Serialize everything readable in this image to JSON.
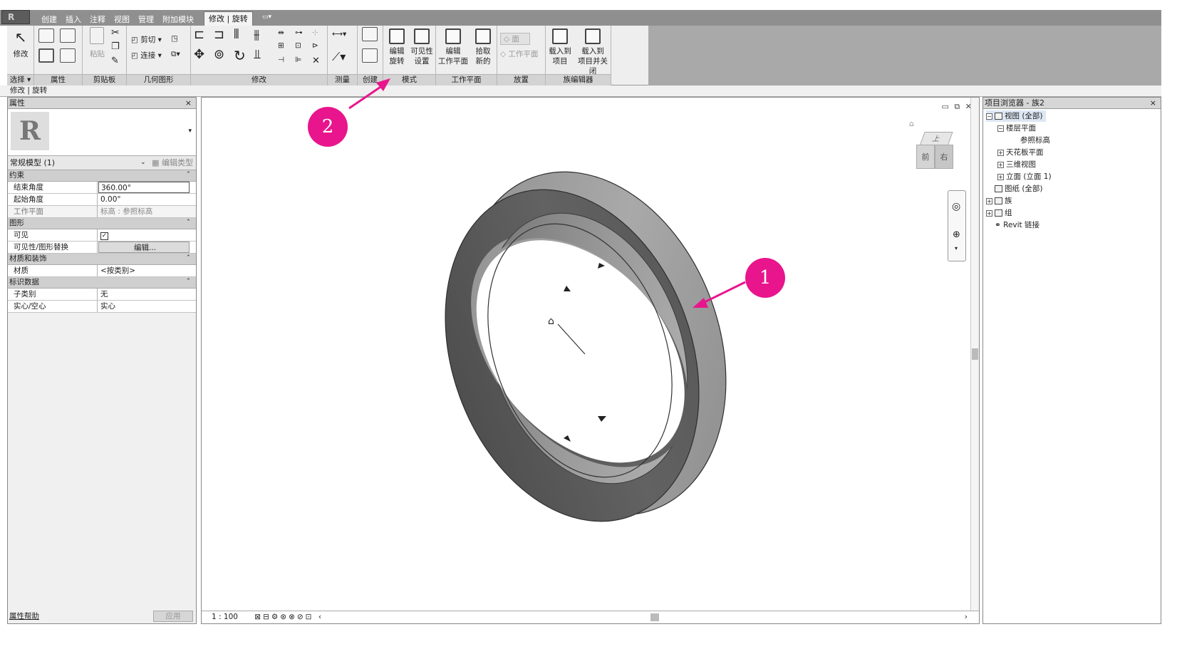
{
  "ribbon": {
    "tabs": [
      "创建",
      "插入",
      "注释",
      "视图",
      "管理",
      "附加模块",
      "修改 | 旋转"
    ],
    "active_tab": "修改 | 旋转",
    "panels": {
      "select": "选择 ▾",
      "properties": "属性",
      "clipboard": "剪贴板",
      "geometry": "几何图形",
      "modify": "修改",
      "measure": "测量",
      "create": "创建",
      "mode": "模式",
      "workplane": "工作平面",
      "place": "放置",
      "family_editor": "族编辑器"
    },
    "buttons": {
      "modify": "修改",
      "paste": "粘贴",
      "cut": "剪切",
      "join": "连接",
      "edit_revolve_1": "编辑",
      "edit_revolve_2": "旋转",
      "visibility_1": "可见性",
      "visibility_2": "设置",
      "edit_wp_1": "编辑",
      "edit_wp_2": "工作平面",
      "pick_new_1": "拾取",
      "pick_new_2": "新的",
      "place_face": "面",
      "place_wp": "工作平面",
      "load_project_1": "载入到",
      "load_project_2": "项目",
      "load_close_1": "载入到",
      "load_close_2": "项目并关闭"
    }
  },
  "context_bar": "修改 | 旋转",
  "properties": {
    "title": "属性",
    "close": "×",
    "type_name": "常规模型 (1)",
    "edit_type": "编辑类型",
    "groups": [
      {
        "name": "约束",
        "rows": [
          {
            "key": "结束角度",
            "value": "360.00°"
          },
          {
            "key": "起始角度",
            "value": "0.00°"
          },
          {
            "key": "工作平面",
            "value": "标高 : 参照标高"
          }
        ]
      },
      {
        "name": "图形",
        "rows": [
          {
            "key": "可见",
            "value": "☑"
          },
          {
            "key": "可见性/图形替换",
            "value": "编辑..."
          }
        ]
      },
      {
        "name": "材质和装饰",
        "rows": [
          {
            "key": "材质",
            "value": "<按类别>"
          }
        ]
      },
      {
        "name": "标识数据",
        "rows": [
          {
            "key": "子类别",
            "value": "无"
          },
          {
            "key": "实心/空心",
            "value": "实心"
          }
        ]
      }
    ],
    "help": "属性帮助",
    "apply": "应用"
  },
  "viewport": {
    "scale": "1 : 100",
    "viewcube_top": "上",
    "viewcube_front": "前",
    "viewcube_right": "右"
  },
  "browser": {
    "title": "项目浏览器 - 族2",
    "close": "×",
    "nodes": [
      "视图 (全部)",
      "楼层平面",
      "参照标高",
      "天花板平面",
      "三维视图",
      "立面 (立面 1)",
      "图纸 (全部)",
      "族",
      "组",
      "Revit 链接"
    ]
  },
  "callouts": [
    "1",
    "2"
  ],
  "colors": {
    "callout": "#e8158c",
    "ring_top": "#9a9a9a",
    "ring_face": "#5e5e5e"
  }
}
